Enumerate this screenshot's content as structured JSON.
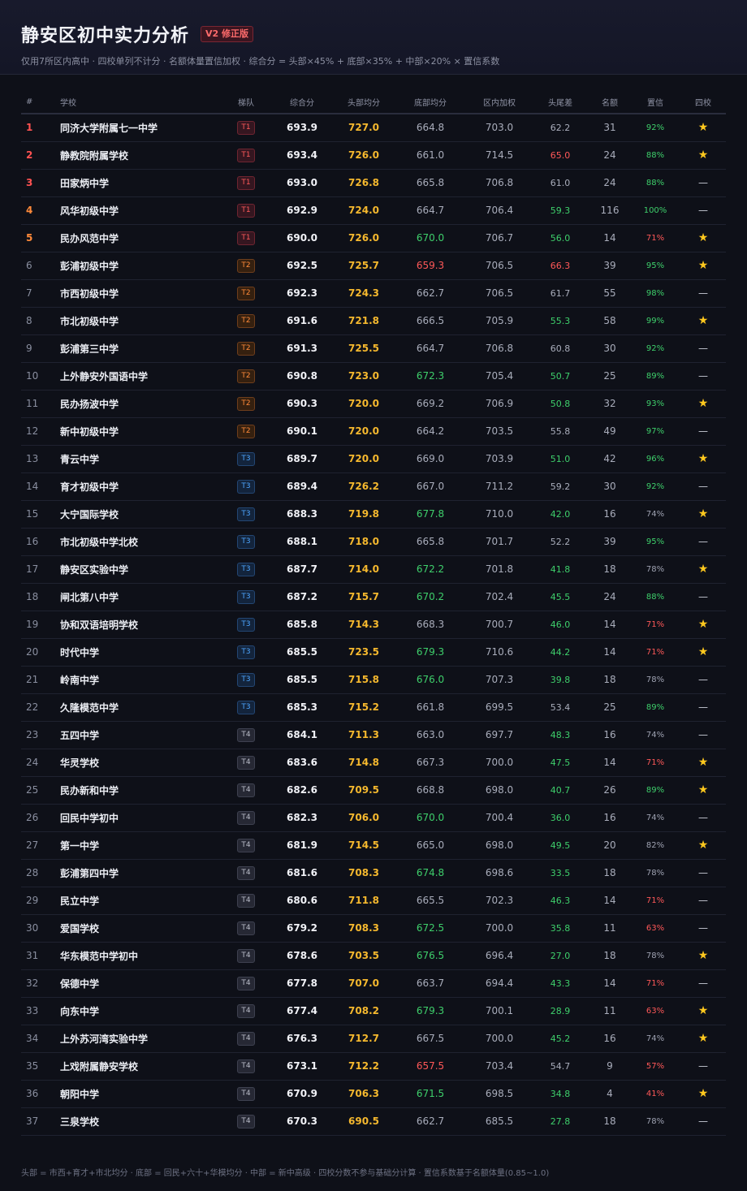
{
  "header": {
    "title": "静安区初中实力分析",
    "badge": "V2 修正版",
    "subtitle": "仅用7所区内高中 · 四校单列不计分 · 名额体量置信加权 · 综合分 = 头部×45% + 底部×35% + 中部×20% × 置信系数"
  },
  "colors": {
    "background": "#0e1018",
    "tier_T1": "#ff5a5a",
    "tier_T2": "#ff8a3a",
    "tier_T3": "#4ea6ff",
    "tier_T4": "#b9bcc8",
    "head_avg": "#f5b82e",
    "good": "#3ecf6b",
    "bad": "#ff5858",
    "star": "#ffc81e"
  },
  "table": {
    "columns": [
      "#",
      "学校",
      "梯队",
      "综合分",
      "头部均分",
      "底部均分",
      "区内加权",
      "头尾差",
      "名额",
      "置信",
      "四校"
    ],
    "rows": [
      {
        "idx": "1",
        "school": "同济大学附属七一中学",
        "tier": "T1",
        "total": "693.9",
        "head": "727.0",
        "bottom": "664.8",
        "bottom_c": "",
        "weighted": "703.0",
        "gap": "62.2",
        "gap_c": "",
        "count": "31",
        "conf": "92%",
        "conf_c": "good",
        "four": "★"
      },
      {
        "idx": "2",
        "school": "静教院附属学校",
        "tier": "T1",
        "total": "693.4",
        "head": "726.0",
        "bottom": "661.0",
        "bottom_c": "",
        "weighted": "714.5",
        "gap": "65.0",
        "gap_c": "bad",
        "count": "24",
        "conf": "88%",
        "conf_c": "good",
        "four": "★"
      },
      {
        "idx": "3",
        "school": "田家炳中学",
        "tier": "T1",
        "total": "693.0",
        "head": "726.8",
        "bottom": "665.8",
        "bottom_c": "",
        "weighted": "706.8",
        "gap": "61.0",
        "gap_c": "",
        "count": "24",
        "conf": "88%",
        "conf_c": "good",
        "four": "—"
      },
      {
        "idx": "4",
        "school": "风华初级中学",
        "tier": "T1",
        "total": "692.9",
        "head": "724.0",
        "bottom": "664.7",
        "bottom_c": "",
        "weighted": "706.4",
        "gap": "59.3",
        "gap_c": "good",
        "count": "116",
        "conf": "100%",
        "conf_c": "good",
        "four": "—"
      },
      {
        "idx": "5",
        "school": "民办风范中学",
        "tier": "T1",
        "total": "690.0",
        "head": "726.0",
        "bottom": "670.0",
        "bottom_c": "good",
        "weighted": "706.7",
        "gap": "56.0",
        "gap_c": "good",
        "count": "14",
        "conf": "71%",
        "conf_c": "bad",
        "four": "★"
      },
      {
        "idx": "6",
        "school": "彭浦初级中学",
        "tier": "T2",
        "total": "692.5",
        "head": "725.7",
        "bottom": "659.3",
        "bottom_c": "bad",
        "weighted": "706.5",
        "gap": "66.3",
        "gap_c": "bad",
        "count": "39",
        "conf": "95%",
        "conf_c": "good",
        "four": "★"
      },
      {
        "idx": "7",
        "school": "市西初级中学",
        "tier": "T2",
        "total": "692.3",
        "head": "724.3",
        "bottom": "662.7",
        "bottom_c": "",
        "weighted": "706.5",
        "gap": "61.7",
        "gap_c": "",
        "count": "55",
        "conf": "98%",
        "conf_c": "good",
        "four": "—"
      },
      {
        "idx": "8",
        "school": "市北初级中学",
        "tier": "T2",
        "total": "691.6",
        "head": "721.8",
        "bottom": "666.5",
        "bottom_c": "",
        "weighted": "705.9",
        "gap": "55.3",
        "gap_c": "good",
        "count": "58",
        "conf": "99%",
        "conf_c": "good",
        "four": "★"
      },
      {
        "idx": "9",
        "school": "彭浦第三中学",
        "tier": "T2",
        "total": "691.3",
        "head": "725.5",
        "bottom": "664.7",
        "bottom_c": "",
        "weighted": "706.8",
        "gap": "60.8",
        "gap_c": "",
        "count": "30",
        "conf": "92%",
        "conf_c": "good",
        "four": "—"
      },
      {
        "idx": "10",
        "school": "上外静安外国语中学",
        "tier": "T2",
        "total": "690.8",
        "head": "723.0",
        "bottom": "672.3",
        "bottom_c": "good",
        "weighted": "705.4",
        "gap": "50.7",
        "gap_c": "good",
        "count": "25",
        "conf": "89%",
        "conf_c": "good",
        "four": "—"
      },
      {
        "idx": "11",
        "school": "民办扬波中学",
        "tier": "T2",
        "total": "690.3",
        "head": "720.0",
        "bottom": "669.2",
        "bottom_c": "",
        "weighted": "706.9",
        "gap": "50.8",
        "gap_c": "good",
        "count": "32",
        "conf": "93%",
        "conf_c": "good",
        "four": "★"
      },
      {
        "idx": "12",
        "school": "新中初级中学",
        "tier": "T2",
        "total": "690.1",
        "head": "720.0",
        "bottom": "664.2",
        "bottom_c": "",
        "weighted": "703.5",
        "gap": "55.8",
        "gap_c": "",
        "count": "49",
        "conf": "97%",
        "conf_c": "good",
        "four": "—"
      },
      {
        "idx": "13",
        "school": "青云中学",
        "tier": "T3",
        "total": "689.7",
        "head": "720.0",
        "bottom": "669.0",
        "bottom_c": "",
        "weighted": "703.9",
        "gap": "51.0",
        "gap_c": "good",
        "count": "42",
        "conf": "96%",
        "conf_c": "good",
        "four": "★"
      },
      {
        "idx": "14",
        "school": "育才初级中学",
        "tier": "T3",
        "total": "689.4",
        "head": "726.2",
        "bottom": "667.0",
        "bottom_c": "",
        "weighted": "711.2",
        "gap": "59.2",
        "gap_c": "",
        "count": "30",
        "conf": "92%",
        "conf_c": "good",
        "four": "—"
      },
      {
        "idx": "15",
        "school": "大宁国际学校",
        "tier": "T3",
        "total": "688.3",
        "head": "719.8",
        "bottom": "677.8",
        "bottom_c": "good",
        "weighted": "710.0",
        "gap": "42.0",
        "gap_c": "good",
        "count": "16",
        "conf": "74%",
        "conf_c": "",
        "four": "★"
      },
      {
        "idx": "16",
        "school": "市北初级中学北校",
        "tier": "T3",
        "total": "688.1",
        "head": "718.0",
        "bottom": "665.8",
        "bottom_c": "",
        "weighted": "701.7",
        "gap": "52.2",
        "gap_c": "",
        "count": "39",
        "conf": "95%",
        "conf_c": "good",
        "four": "—"
      },
      {
        "idx": "17",
        "school": "静安区实验中学",
        "tier": "T3",
        "total": "687.7",
        "head": "714.0",
        "bottom": "672.2",
        "bottom_c": "good",
        "weighted": "701.8",
        "gap": "41.8",
        "gap_c": "good",
        "count": "18",
        "conf": "78%",
        "conf_c": "",
        "four": "★"
      },
      {
        "idx": "18",
        "school": "闸北第八中学",
        "tier": "T3",
        "total": "687.2",
        "head": "715.7",
        "bottom": "670.2",
        "bottom_c": "good",
        "weighted": "702.4",
        "gap": "45.5",
        "gap_c": "good",
        "count": "24",
        "conf": "88%",
        "conf_c": "good",
        "four": "—"
      },
      {
        "idx": "19",
        "school": "协和双语培明学校",
        "tier": "T3",
        "total": "685.8",
        "head": "714.3",
        "bottom": "668.3",
        "bottom_c": "",
        "weighted": "700.7",
        "gap": "46.0",
        "gap_c": "good",
        "count": "14",
        "conf": "71%",
        "conf_c": "bad",
        "four": "★"
      },
      {
        "idx": "20",
        "school": "时代中学",
        "tier": "T3",
        "total": "685.5",
        "head": "723.5",
        "bottom": "679.3",
        "bottom_c": "good",
        "weighted": "710.6",
        "gap": "44.2",
        "gap_c": "good",
        "count": "14",
        "conf": "71%",
        "conf_c": "bad",
        "four": "★"
      },
      {
        "idx": "21",
        "school": "岭南中学",
        "tier": "T3",
        "total": "685.5",
        "head": "715.8",
        "bottom": "676.0",
        "bottom_c": "good",
        "weighted": "707.3",
        "gap": "39.8",
        "gap_c": "good",
        "count": "18",
        "conf": "78%",
        "conf_c": "",
        "four": "—"
      },
      {
        "idx": "22",
        "school": "久隆模范中学",
        "tier": "T3",
        "total": "685.3",
        "head": "715.2",
        "bottom": "661.8",
        "bottom_c": "",
        "weighted": "699.5",
        "gap": "53.4",
        "gap_c": "",
        "count": "25",
        "conf": "89%",
        "conf_c": "good",
        "four": "—"
      },
      {
        "idx": "23",
        "school": "五四中学",
        "tier": "T4",
        "total": "684.1",
        "head": "711.3",
        "bottom": "663.0",
        "bottom_c": "",
        "weighted": "697.7",
        "gap": "48.3",
        "gap_c": "good",
        "count": "16",
        "conf": "74%",
        "conf_c": "",
        "four": "—"
      },
      {
        "idx": "24",
        "school": "华灵学校",
        "tier": "T4",
        "total": "683.6",
        "head": "714.8",
        "bottom": "667.3",
        "bottom_c": "",
        "weighted": "700.0",
        "gap": "47.5",
        "gap_c": "good",
        "count": "14",
        "conf": "71%",
        "conf_c": "bad",
        "four": "★"
      },
      {
        "idx": "25",
        "school": "民办新和中学",
        "tier": "T4",
        "total": "682.6",
        "head": "709.5",
        "bottom": "668.8",
        "bottom_c": "",
        "weighted": "698.0",
        "gap": "40.7",
        "gap_c": "good",
        "count": "26",
        "conf": "89%",
        "conf_c": "good",
        "four": "★"
      },
      {
        "idx": "26",
        "school": "回民中学初中",
        "tier": "T4",
        "total": "682.3",
        "head": "706.0",
        "bottom": "670.0",
        "bottom_c": "good",
        "weighted": "700.4",
        "gap": "36.0",
        "gap_c": "good",
        "count": "16",
        "conf": "74%",
        "conf_c": "",
        "four": "—"
      },
      {
        "idx": "27",
        "school": "第一中学",
        "tier": "T4",
        "total": "681.9",
        "head": "714.5",
        "bottom": "665.0",
        "bottom_c": "",
        "weighted": "698.0",
        "gap": "49.5",
        "gap_c": "good",
        "count": "20",
        "conf": "82%",
        "conf_c": "",
        "four": "★"
      },
      {
        "idx": "28",
        "school": "彭浦第四中学",
        "tier": "T4",
        "total": "681.6",
        "head": "708.3",
        "bottom": "674.8",
        "bottom_c": "good",
        "weighted": "698.6",
        "gap": "33.5",
        "gap_c": "good",
        "count": "18",
        "conf": "78%",
        "conf_c": "",
        "four": "—"
      },
      {
        "idx": "29",
        "school": "民立中学",
        "tier": "T4",
        "total": "680.6",
        "head": "711.8",
        "bottom": "665.5",
        "bottom_c": "",
        "weighted": "702.3",
        "gap": "46.3",
        "gap_c": "good",
        "count": "14",
        "conf": "71%",
        "conf_c": "bad",
        "four": "—"
      },
      {
        "idx": "30",
        "school": "爱国学校",
        "tier": "T4",
        "total": "679.2",
        "head": "708.3",
        "bottom": "672.5",
        "bottom_c": "good",
        "weighted": "700.0",
        "gap": "35.8",
        "gap_c": "good",
        "count": "11",
        "conf": "63%",
        "conf_c": "bad",
        "four": "—"
      },
      {
        "idx": "31",
        "school": "华东模范中学初中",
        "tier": "T4",
        "total": "678.6",
        "head": "703.5",
        "bottom": "676.5",
        "bottom_c": "good",
        "weighted": "696.4",
        "gap": "27.0",
        "gap_c": "good",
        "count": "18",
        "conf": "78%",
        "conf_c": "",
        "four": "★"
      },
      {
        "idx": "32",
        "school": "保德中学",
        "tier": "T4",
        "total": "677.8",
        "head": "707.0",
        "bottom": "663.7",
        "bottom_c": "",
        "weighted": "694.4",
        "gap": "43.3",
        "gap_c": "good",
        "count": "14",
        "conf": "71%",
        "conf_c": "bad",
        "four": "—"
      },
      {
        "idx": "33",
        "school": "向东中学",
        "tier": "T4",
        "total": "677.4",
        "head": "708.2",
        "bottom": "679.3",
        "bottom_c": "good",
        "weighted": "700.1",
        "gap": "28.9",
        "gap_c": "good",
        "count": "11",
        "conf": "63%",
        "conf_c": "bad",
        "four": "★"
      },
      {
        "idx": "34",
        "school": "上外苏河湾实验中学",
        "tier": "T4",
        "total": "676.3",
        "head": "712.7",
        "bottom": "667.5",
        "bottom_c": "",
        "weighted": "700.0",
        "gap": "45.2",
        "gap_c": "good",
        "count": "16",
        "conf": "74%",
        "conf_c": "",
        "four": "★"
      },
      {
        "idx": "35",
        "school": "上戏附属静安学校",
        "tier": "T4",
        "total": "673.1",
        "head": "712.2",
        "bottom": "657.5",
        "bottom_c": "bad",
        "weighted": "703.4",
        "gap": "54.7",
        "gap_c": "",
        "count": "9",
        "conf": "57%",
        "conf_c": "bad",
        "four": "—"
      },
      {
        "idx": "36",
        "school": "朝阳中学",
        "tier": "T4",
        "total": "670.9",
        "head": "706.3",
        "bottom": "671.5",
        "bottom_c": "good",
        "weighted": "698.5",
        "gap": "34.8",
        "gap_c": "good",
        "count": "4",
        "conf": "41%",
        "conf_c": "bad",
        "four": "★"
      },
      {
        "idx": "37",
        "school": "三泉学校",
        "tier": "T4",
        "total": "670.3",
        "head": "690.5",
        "bottom": "662.7",
        "bottom_c": "",
        "weighted": "685.5",
        "gap": "27.8",
        "gap_c": "good",
        "count": "18",
        "conf": "78%",
        "conf_c": "",
        "four": "—"
      }
    ]
  },
  "footer": {
    "note": "头部 = 市西+育才+市北均分 · 底部 = 回民+六十+华模均分 · 中部 = 新中高级 · 四校分数不参与基础分计算 · 置信系数基于名额体量(0.85~1.0)"
  }
}
